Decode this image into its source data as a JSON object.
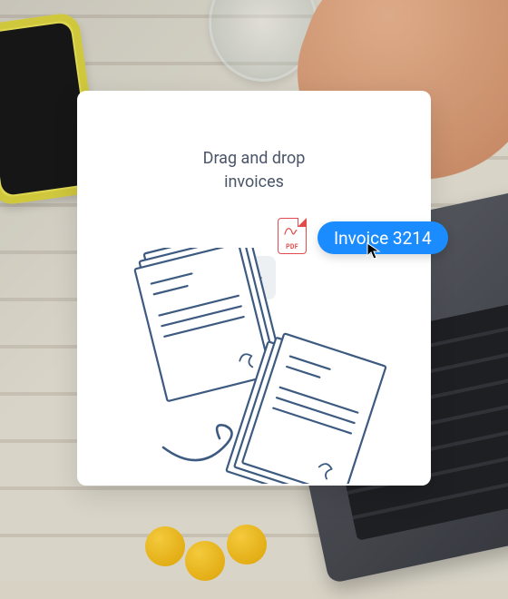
{
  "dropzone": {
    "title_line1": "Drag and drop",
    "title_line2": "invoices"
  },
  "dragged_file": {
    "name": "Invoice 3214",
    "extension": "PDF",
    "chip_color": "#1b8cff"
  },
  "icons": {
    "plus": "plus-icon",
    "pdf": "pdf-file-icon",
    "cursor": "cursor-icon"
  }
}
